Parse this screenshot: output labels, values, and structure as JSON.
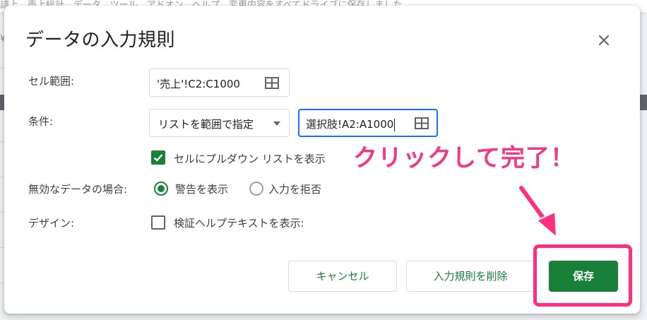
{
  "background": {
    "top_text": "請上、売上総計、データ、ツール、アドオン、ヘルプ　変更内容をすべてドライブに保存しました",
    "yen": "¥"
  },
  "dialog": {
    "title": "データの入力規則",
    "close_icon": "close-icon"
  },
  "cell_range": {
    "label": "セル範囲:",
    "value": "'売上'!C2:C1000",
    "icon": "grid-icon"
  },
  "criteria": {
    "label": "条件:",
    "type_selected": "リストを範囲で指定",
    "range_value": "選択肢!A2:A1000",
    "icon": "grid-icon"
  },
  "dropdown_option": {
    "label": "セルにプルダウン リストを表示",
    "checked": true
  },
  "invalid_data": {
    "label": "無効なデータの場合:",
    "options": [
      {
        "label": "警告を表示",
        "selected": true
      },
      {
        "label": "入力を拒否",
        "selected": false
      }
    ]
  },
  "design": {
    "label": "デザイン:",
    "help_text_label": "検証ヘルプテキストを表示:",
    "checked": false
  },
  "buttons": {
    "cancel": "キャンセル",
    "delete": "入力規則を削除",
    "save": "保存"
  },
  "annotation": {
    "text": "クリックして完了！",
    "color": "#f03884"
  },
  "colors": {
    "accent_green": "#188038",
    "focus_blue": "#1a73e8",
    "highlight_pink": "#ff2f7f"
  }
}
